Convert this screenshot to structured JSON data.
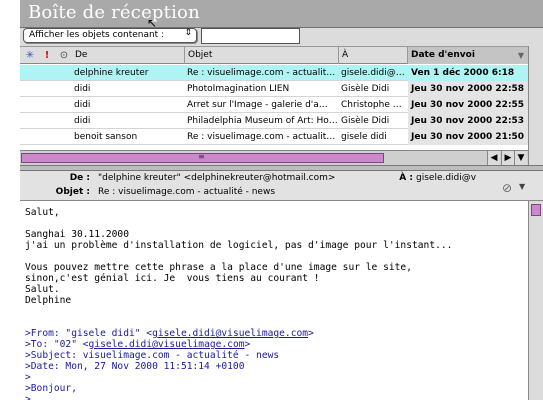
{
  "window": {
    "title": "Boîte de réception"
  },
  "filter": {
    "select_label": "Afficher les objets contenant :",
    "input_value": ""
  },
  "columns": {
    "from": "De",
    "subject": "Objet",
    "to": "À",
    "date": "Date d'envoi"
  },
  "messages": [
    {
      "from": "delphine kreuter",
      "subject": "Re : visuelimage.com - actualit…",
      "to": "gisele.didi@…",
      "date": "Ven 1 déc 2000 6:18",
      "selected": true
    },
    {
      "from": "didi",
      "subject": "PhotoImagination LIEN",
      "to": "Gisèle Didi",
      "date": "Jeu 30 nov 2000 22:58",
      "selected": false
    },
    {
      "from": "didi",
      "subject": "Arret sur l'Image - galerie d'a…",
      "to": "Christophe …",
      "date": "Jeu 30 nov 2000 22:55",
      "selected": false
    },
    {
      "from": "didi",
      "subject": "Philadelphia Museum of Art: Ho…",
      "to": "Gisèle Didi",
      "date": "Jeu 30 nov 2000 22:53",
      "selected": false
    },
    {
      "from": "benoit sanson",
      "subject": "Re : visuelimage.com - actualit…",
      "to": "gisele didi",
      "date": "Jeu 30 nov 2000 21:50",
      "selected": false
    }
  ],
  "header": {
    "from_label": "De :",
    "from_value": "\"delphine kreuter\" <delphinekreuter@hotmail.com>",
    "to_label": "À :",
    "to_value": "gisele.didi@v",
    "subject_label": "Objet :",
    "subject_value": "Re : visuelimage.com - actualité - news"
  },
  "body": {
    "l1": "Salut,",
    "l2": "Sanghai 30.11.2000",
    "l3": "j'ai un problème d'installation de logiciel, pas d'image pour l'instant...",
    "l4": "Vous pouvez mettre cette phrase a la place d'une image sur le site,",
    "l5": "sinon,c'est génial ici. Je  vous tiens au courant !",
    "l6": "Salut.",
    "l7": "Delphine",
    "q1_prefix": ">From: \"gisele didi\" <",
    "q1_link": "gisele.didi@visuelimage.com",
    "q1_suffix": ">",
    "q2_prefix": ">To: \"02\" <",
    "q2_link": "gisele.didi@visuelimage.com",
    "q2_suffix": ">",
    "q3": ">Subject: visuelimage.com - actualité - news",
    "q4": ">Date: Mon, 27 Nov 2000 11:51:14 +0100",
    "q5": ">",
    "q6": ">Bonjour,",
    "q7": ">"
  }
}
